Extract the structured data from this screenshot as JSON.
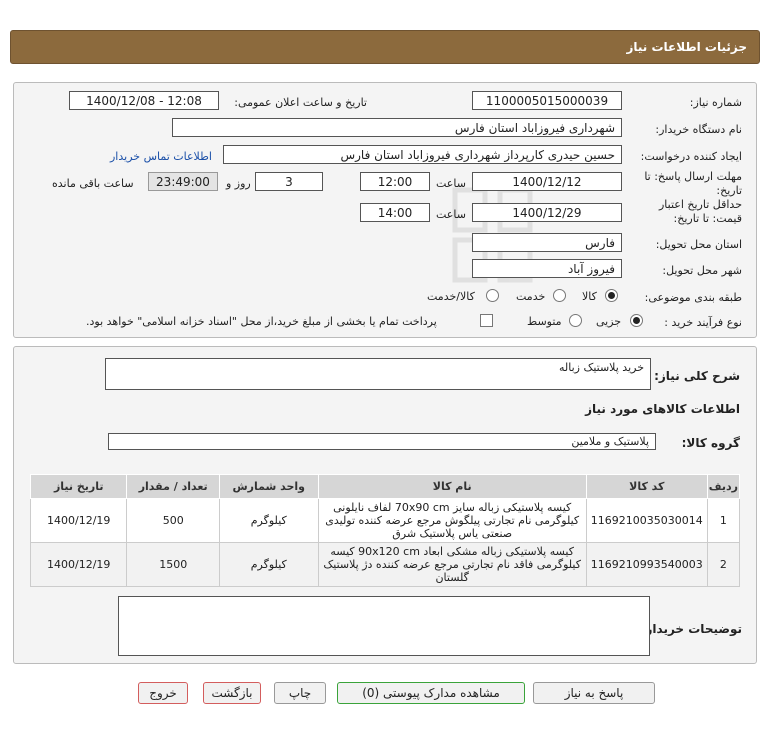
{
  "header": {
    "title": "جزئیات اطلاعات نیاز"
  },
  "info": {
    "need_number_label": "شماره نیاز:",
    "need_number": "1100005015000039",
    "announce_label": "تاریخ و ساعت اعلان عمومی:",
    "announce_value": "1400/12/08 - 12:08",
    "buyer_org_label": "نام دستگاه خریدار:",
    "buyer_org": "شهرداری فیروزاباد استان فارس",
    "creator_label": "ایجاد کننده درخواست:",
    "creator": "حسین حیدری کارپرداز شهرداری فیروزاباد استان فارس",
    "contact_link": "اطلاعات تماس خریدار",
    "deadline_label": "مهلت ارسال پاسخ: تا تاریخ:",
    "deadline_date": "1400/12/12",
    "time_label": "ساعت",
    "deadline_time": "12:00",
    "days_value": "3",
    "days_label": "روز و",
    "remaining_time": "23:49:00",
    "remaining_label": "ساعت باقی مانده",
    "validity_label": "حداقل تاریخ اعتبار قیمت: تا تاریخ:",
    "validity_date": "1400/12/29",
    "validity_time": "14:00",
    "province_label": "استان محل تحویل:",
    "province": "فارس",
    "city_label": "شهر محل تحویل:",
    "city": "فیروز آباد",
    "category_label": "طبقه بندی موضوعی:",
    "category_options": [
      "کالا",
      "خدمت",
      "کالا/خدمت"
    ],
    "process_label": "نوع فرآیند خرید :",
    "process_options": [
      "جزیی",
      "متوسط"
    ],
    "payment_note": "پرداخت تمام یا بخشی از مبلغ خرید،از محل \"اسناد خزانه اسلامی\" خواهد بود."
  },
  "details": {
    "summary_label": "شرح کلی نیاز:",
    "summary": "خرید پلاستیک زباله",
    "goods_info_title": "اطلاعات کالاهای مورد نیاز",
    "group_label": "گروه کالا:",
    "group_value": "پلاستیک و ملامین",
    "table": {
      "headers": [
        "ردیف",
        "کد کالا",
        "نام کالا",
        "واحد شمارش",
        "تعداد / مقدار",
        "تاریخ نیاز"
      ],
      "rows": [
        {
          "row": "1",
          "code": "1169210035030014",
          "name": "کیسه پلاستیکی زباله سایز 70x90 cm لفاف نایلونی کیلوگرمی نام تجارتی پیلگوش مرجع عرضه کننده تولیدی صنعتی یاس پلاستیک شرق",
          "unit": "کیلوگرم",
          "qty": "500",
          "date": "1400/12/19"
        },
        {
          "row": "2",
          "code": "1169210993540003",
          "name": "کیسه پلاستیکی زباله مشکی ابعاد 90x120 cm کیسه کیلوگرمی فاقد نام تجارتی مرجع عرضه کننده دژ پلاستیک گلستان",
          "unit": "کیلوگرم",
          "qty": "1500",
          "date": "1400/12/19"
        }
      ]
    },
    "buyer_notes_label": "توضیحات خریدار:"
  },
  "buttons": {
    "reply": "پاسخ به نیاز",
    "view_docs": "مشاهده مدارک پیوستی (0)",
    "print": "چاپ",
    "back": "بازگشت",
    "exit": "خروج"
  },
  "colors": {
    "header_bg": "#8c6a3d",
    "link": "#1a4fa8",
    "remaining_bg": "#e4e4e4"
  }
}
